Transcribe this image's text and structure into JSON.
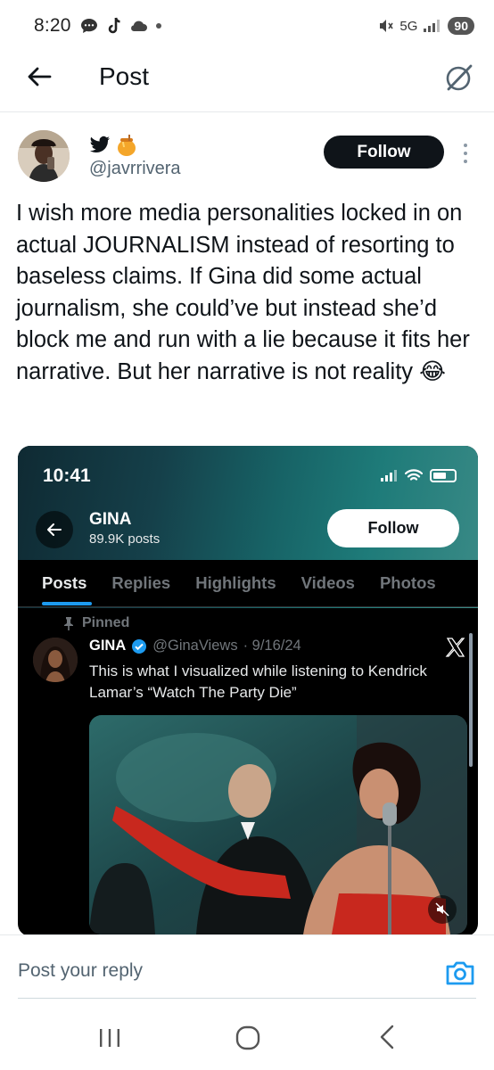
{
  "status_bar": {
    "time": "8:20",
    "network": "5G",
    "battery": "90",
    "icons": [
      "chat-bubble-icon",
      "tiktok-icon",
      "cloud-icon",
      "dot-icon",
      "mute-icon",
      "signal-icon"
    ]
  },
  "header": {
    "title": "Post",
    "back_icon": "arrow-left-icon",
    "grok_icon": "grok-icon"
  },
  "author": {
    "handle": "@javrrivera",
    "emojis": [
      "bird-emoji",
      "honey-pot-emoji"
    ],
    "follow_label": "Follow"
  },
  "tweet": {
    "text": "I wish more media personalities locked in on actual JOURNALISM instead of resorting to baseless claims. If Gina did some actual journalism, she could’ve but instead she’d block me and run with a lie because it fits her narrative. But her narrative is not reality 😂"
  },
  "embed": {
    "time": "10:41",
    "profile_name": "GINA",
    "post_count": "89.9K posts",
    "follow_label": "Follow",
    "tabs": [
      "Posts",
      "Replies",
      "Highlights",
      "Videos",
      "Photos"
    ],
    "active_tab": "Posts",
    "pinned_label": "Pinned",
    "post": {
      "name": "GINA",
      "handle": "@GinaViews",
      "date": "· 9/16/24",
      "text": "This is what I visualized while listening to Kendrick Lamar’s “Watch The Party Die”"
    }
  },
  "reply": {
    "placeholder": "Post your reply"
  },
  "colors": {
    "accent": "#1d9bf0",
    "text": "#0f1419",
    "muted": "#536471"
  }
}
